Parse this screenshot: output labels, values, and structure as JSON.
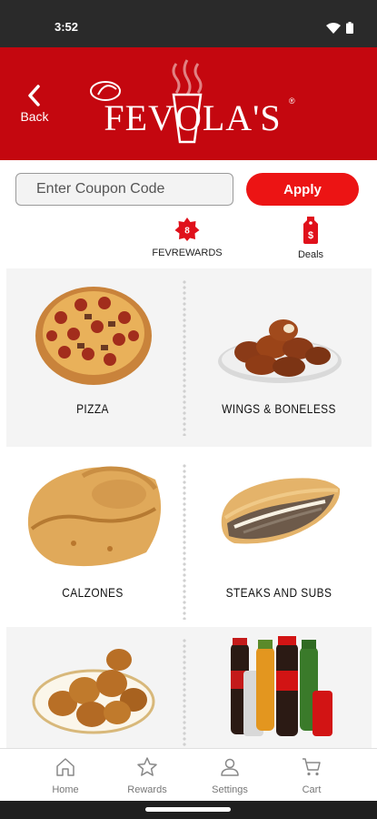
{
  "status_bar": {
    "time": "3:52"
  },
  "header": {
    "back_label": "Back",
    "brand": "FEVOLA'S"
  },
  "coupon": {
    "placeholder": "Enter Coupon Code",
    "apply_label": "Apply"
  },
  "quick_links": [
    {
      "label": "FEVREWARDS",
      "icon": "rewards-badge-icon"
    },
    {
      "label": "Deals",
      "icon": "deals-tag-icon"
    }
  ],
  "categories": [
    {
      "label": "PIZZA",
      "image": "pizza-image"
    },
    {
      "label": "WINGS & BONELESS",
      "image": "wings-image"
    },
    {
      "label": "CALZONES",
      "image": "calzone-image"
    },
    {
      "label": "STEAKS AND SUBS",
      "image": "steak-sub-image"
    },
    {
      "label": "",
      "image": "pretzel-bites-image"
    },
    {
      "label": "",
      "image": "drinks-image"
    }
  ],
  "bottom_nav": [
    {
      "label": "Home",
      "icon": "home-icon"
    },
    {
      "label": "Rewards",
      "icon": "star-icon"
    },
    {
      "label": "Settings",
      "icon": "user-icon"
    },
    {
      "label": "Cart",
      "icon": "cart-icon"
    }
  ],
  "colors": {
    "brand_red": "#c4070f",
    "apply_red": "#ec1414",
    "icon_red": "#e0101b"
  }
}
